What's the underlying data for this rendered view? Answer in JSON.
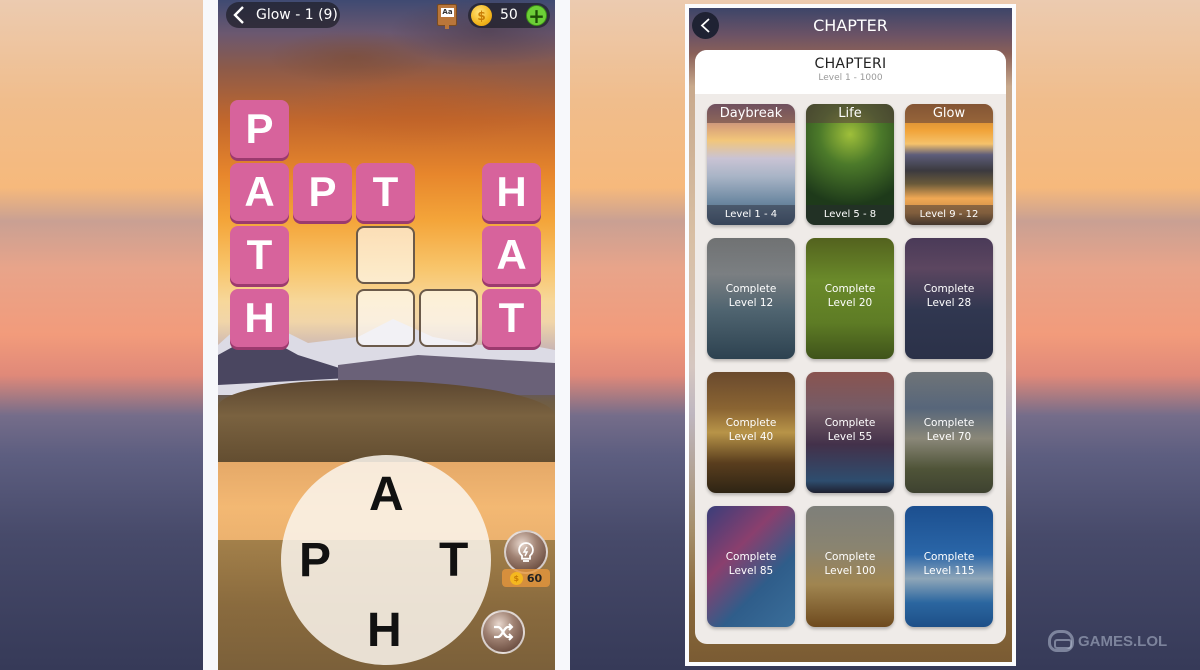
{
  "game_screen": {
    "level_label": "Glow - 1 (9)",
    "coins": "50",
    "dictionary_glyph": "Aa",
    "coin_glyph": "$",
    "plus_glyph": "+",
    "hint_cost": "60",
    "grid_tiles": [
      {
        "letter": "P",
        "state": "filled",
        "col": 0,
        "row": 0
      },
      {
        "letter": "A",
        "state": "filled",
        "col": 0,
        "row": 1
      },
      {
        "letter": "P",
        "state": "filled",
        "col": 1,
        "row": 1
      },
      {
        "letter": "T",
        "state": "filled",
        "col": 2,
        "row": 1
      },
      {
        "letter": "H",
        "state": "filled",
        "col": 4,
        "row": 1
      },
      {
        "letter": "T",
        "state": "filled",
        "col": 0,
        "row": 2
      },
      {
        "letter": "",
        "state": "empty",
        "col": 2,
        "row": 2
      },
      {
        "letter": "A",
        "state": "filled",
        "col": 4,
        "row": 2
      },
      {
        "letter": "H",
        "state": "filled",
        "col": 0,
        "row": 3
      },
      {
        "letter": "",
        "state": "empty",
        "col": 2,
        "row": 3
      },
      {
        "letter": "",
        "state": "empty",
        "col": 3,
        "row": 3
      },
      {
        "letter": "T",
        "state": "filled",
        "col": 4,
        "row": 3
      }
    ],
    "wheel_letters": {
      "top": "A",
      "left": "P",
      "right": "T",
      "bottom": "H"
    },
    "tile_color": "#d7639c"
  },
  "chapter_screen": {
    "header_title": "CHAPTER",
    "chapter_title": "CHAPTERI",
    "chapter_range": "Level 1 - 1000",
    "levels": [
      {
        "name": "Daybreak",
        "range": "Level 1 - 4",
        "type": "unlocked"
      },
      {
        "name": "Life",
        "range": "Level 5 - 8",
        "type": "unlocked"
      },
      {
        "name": "Glow",
        "range": "Level 9 - 12",
        "type": "unlocked"
      },
      {
        "line1": "Complete",
        "line2": "Level 12",
        "type": "locked"
      },
      {
        "line1": "Complete",
        "line2": "Level 20",
        "type": "locked"
      },
      {
        "line1": "Complete",
        "line2": "Level 28",
        "type": "locked"
      },
      {
        "line1": "Complete",
        "line2": "Level 40",
        "type": "locked"
      },
      {
        "line1": "Complete",
        "line2": "Level 55",
        "type": "locked"
      },
      {
        "line1": "Complete",
        "line2": "Level 70",
        "type": "locked"
      },
      {
        "line1": "Complete",
        "line2": "Level 85",
        "type": "locked"
      },
      {
        "line1": "Complete",
        "line2": "Level 100",
        "type": "locked"
      },
      {
        "line1": "Complete",
        "line2": "Level 115",
        "type": "locked"
      }
    ]
  },
  "watermark": "GAMES.LOL"
}
